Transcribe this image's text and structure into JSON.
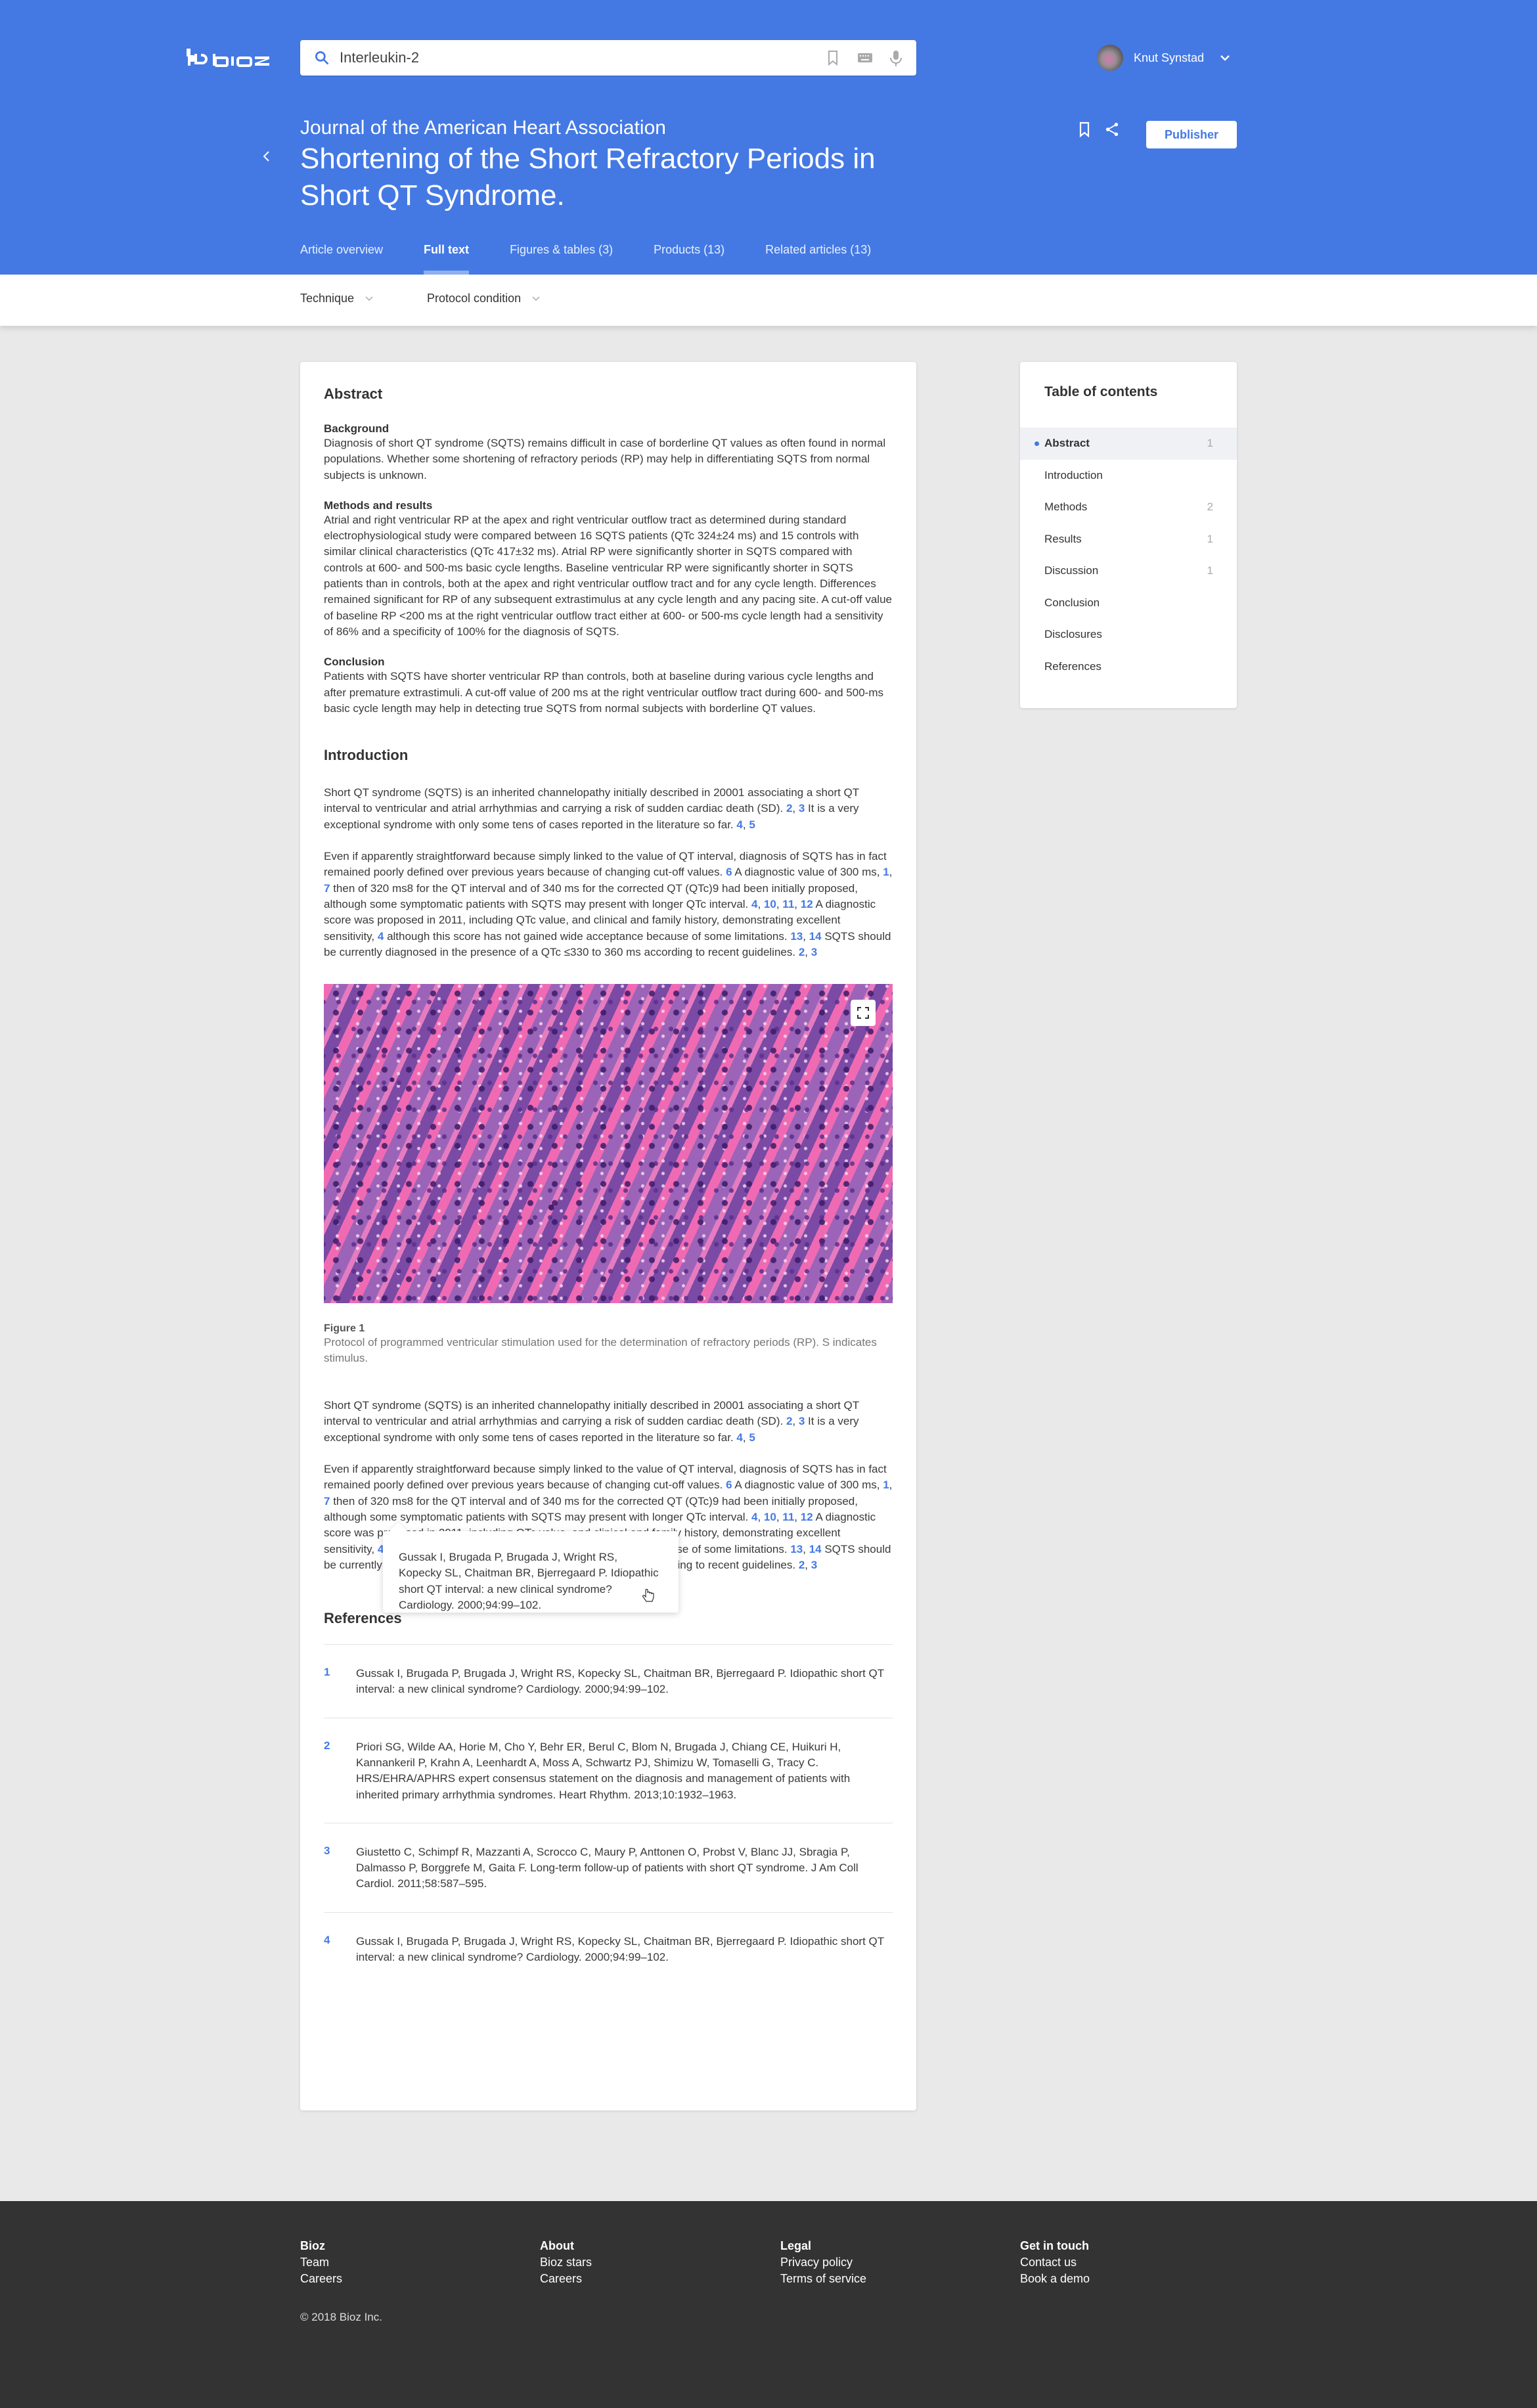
{
  "brand": {
    "name": "bioz",
    "color_primary": "#4479e4"
  },
  "search": {
    "value": "Interleukin-2",
    "placeholder": "Search"
  },
  "user": {
    "name": "Knut Synstad"
  },
  "article_header": {
    "journal": "Journal of the American Heart Association",
    "title": "Shortening of the Short Refractory Periods in Short QT Syndrome.",
    "publisher_label": "Publisher"
  },
  "tabs": [
    {
      "label": "Article overview",
      "active": false
    },
    {
      "label": "Full text",
      "active": true
    },
    {
      "label": "Figures & tables (3)",
      "active": false
    },
    {
      "label": "Products (13)",
      "active": false
    },
    {
      "label": "Related articles (13)",
      "active": false
    }
  ],
  "filters": [
    {
      "label": "Technique"
    },
    {
      "label": "Protocol condition"
    }
  ],
  "abstract": {
    "heading": "Abstract",
    "background_heading": "Background",
    "background_text": "Diagnosis of short QT syndrome (SQTS) remains difficult in case of borderline QT values as often found in normal populations. Whether some shortening of refractory periods (RP) may help in differentiating SQTS from normal subjects is unknown.",
    "methods_heading": "Methods and results",
    "methods_text": "Atrial and right ventricular RP at the apex and right ventricular outflow tract as determined during standard electrophysiological study were compared between 16 SQTS patients (QTc 324±24 ms) and 15 controls with similar clinical characteristics (QTc 417±32 ms). Atrial RP were significantly shorter in SQTS compared with controls at 600- and 500-ms basic cycle lengths. Baseline ventricular RP were significantly shorter in SQTS patients than in controls, both at the apex and right ventricular outflow tract and for any cycle length. Differences remained significant for RP of any subsequent extrastimulus at any cycle length and any pacing site. A cut-off value of baseline RP <200 ms at the right ventricular outflow tract either at 600- or 500-ms cycle length had a sensitivity of 86% and a specificity of 100% for the diagnosis of SQTS.",
    "conclusion_heading": "Conclusion",
    "conclusion_text": "Patients with SQTS have shorter ventricular RP than controls, both at baseline during various cycle lengths and after premature extrastimuli. A cut-off value of 200 ms at the right ventricular outflow tract during 600- and 500-ms basic cycle length may help in detecting true SQTS from normal subjects with borderline QT values."
  },
  "introduction": {
    "heading": "Introduction",
    "p1": {
      "t1": "Short QT syndrome (SQTS) is an inherited channelopathy initially described in 20001 associating a short QT interval to ventricular and atrial arrhythmias and carrying a risk of sudden cardiac death (SD). ",
      "r1": "2",
      "r2": "3",
      "t2": " It is a very exceptional syndrome with only some tens of cases reported in the literature so far. ",
      "r3": "4",
      "r4": "5"
    },
    "p2": {
      "t1": "Even if apparently straightforward because simply linked to the value of QT interval, diagnosis of SQTS has in fact remained poorly defined over previous years because of changing cut-off values. ",
      "r1": "6",
      "t2": " A diagnostic value of 300 ms, ",
      "r2": "1",
      "r3": "7",
      "t3": " then of 320 ms8 for the QT interval and of 340 ms for the corrected QT (QTc)9 had been initially proposed, although some symptomatic patients with SQTS may present with longer QTc interval. ",
      "r4": "4",
      "r5": "10",
      "r6": "11",
      "r7": "12",
      "t4": " A diagnostic score was proposed in 2011, including QTc value, and clinical and family history, demonstrating excellent sensitivity, ",
      "r8": "4",
      "t5": " although this score has not gained wide acceptance because of some limitations. ",
      "r9": "13",
      "r10": "14",
      "t6": " SQTS should be currently diagnosed in the presence of a QTc ≤330 to 360 ms according to recent guidelines. ",
      "r11": "2",
      "r12": "3"
    }
  },
  "figure": {
    "title": "Figure 1",
    "caption": "Protocol of programmed ventricular stimulation used for the determination of refractory periods (RP). S indicates stimulus.",
    "expand_icon": "expand-icon"
  },
  "tooltip": {
    "text": "Gussak I, Brugada P, Brugada J, Wright RS, Kopecky SL, Chaitman BR, Bjerregaard P. Idiopathic short QT interval: a new clinical syndrome? Cardiology. 2000;94:99–102."
  },
  "references": {
    "heading": "References",
    "items": [
      {
        "num": "1",
        "text": "Gussak I, Brugada P, Brugada J, Wright RS, Kopecky SL, Chaitman BR, Bjerregaard P. Idiopathic short QT interval: a new clinical syndrome? Cardiology. 2000;94:99–102."
      },
      {
        "num": "2",
        "text": "Priori SG, Wilde AA, Horie M, Cho Y, Behr ER, Berul C, Blom N, Brugada J, Chiang CE, Huikuri H, Kannankeril P, Krahn A, Leenhardt A, Moss A, Schwartz PJ, Shimizu W, Tomaselli G, Tracy C. HRS/EHRA/APHRS expert consensus statement on the diagnosis and management of patients with inherited primary arrhythmia syndromes. Heart Rhythm. 2013;10:1932–1963."
      },
      {
        "num": "3",
        "text": "Giustetto C, Schimpf R, Mazzanti A, Scrocco C, Maury P, Anttonen O, Probst V, Blanc JJ, Sbragia P, Dalmasso P, Borggrefe M, Gaita F. Long-term follow-up of patients with short QT syndrome. J Am Coll Cardiol. 2011;58:587–595."
      },
      {
        "num": "4",
        "text": "Gussak I, Brugada P, Brugada J, Wright RS, Kopecky SL, Chaitman BR, Bjerregaard P. Idiopathic short QT interval: a new clinical syndrome? Cardiology. 2000;94:99–102."
      }
    ]
  },
  "toc": {
    "title": "Table of contents",
    "items": [
      {
        "label": "Abstract",
        "count": "1",
        "active": true
      },
      {
        "label": "Introduction",
        "count": ""
      },
      {
        "label": "Methods",
        "count": "2"
      },
      {
        "label": "Results",
        "count": "1"
      },
      {
        "label": "Discussion",
        "count": "1"
      },
      {
        "label": "Conclusion",
        "count": ""
      },
      {
        "label": "Disclosures",
        "count": ""
      },
      {
        "label": "References",
        "count": ""
      }
    ]
  },
  "footer": {
    "columns": [
      {
        "heading": "Bioz",
        "links": [
          "Team",
          "Careers"
        ]
      },
      {
        "heading": "About",
        "links": [
          "Bioz stars",
          "Careers"
        ]
      },
      {
        "heading": "Legal",
        "links": [
          "Privacy policy",
          "Terms of service"
        ]
      },
      {
        "heading": "Get in touch",
        "links": [
          "Contact us",
          "Book a demo"
        ]
      }
    ],
    "copyright": "© 2018 Bioz Inc."
  }
}
